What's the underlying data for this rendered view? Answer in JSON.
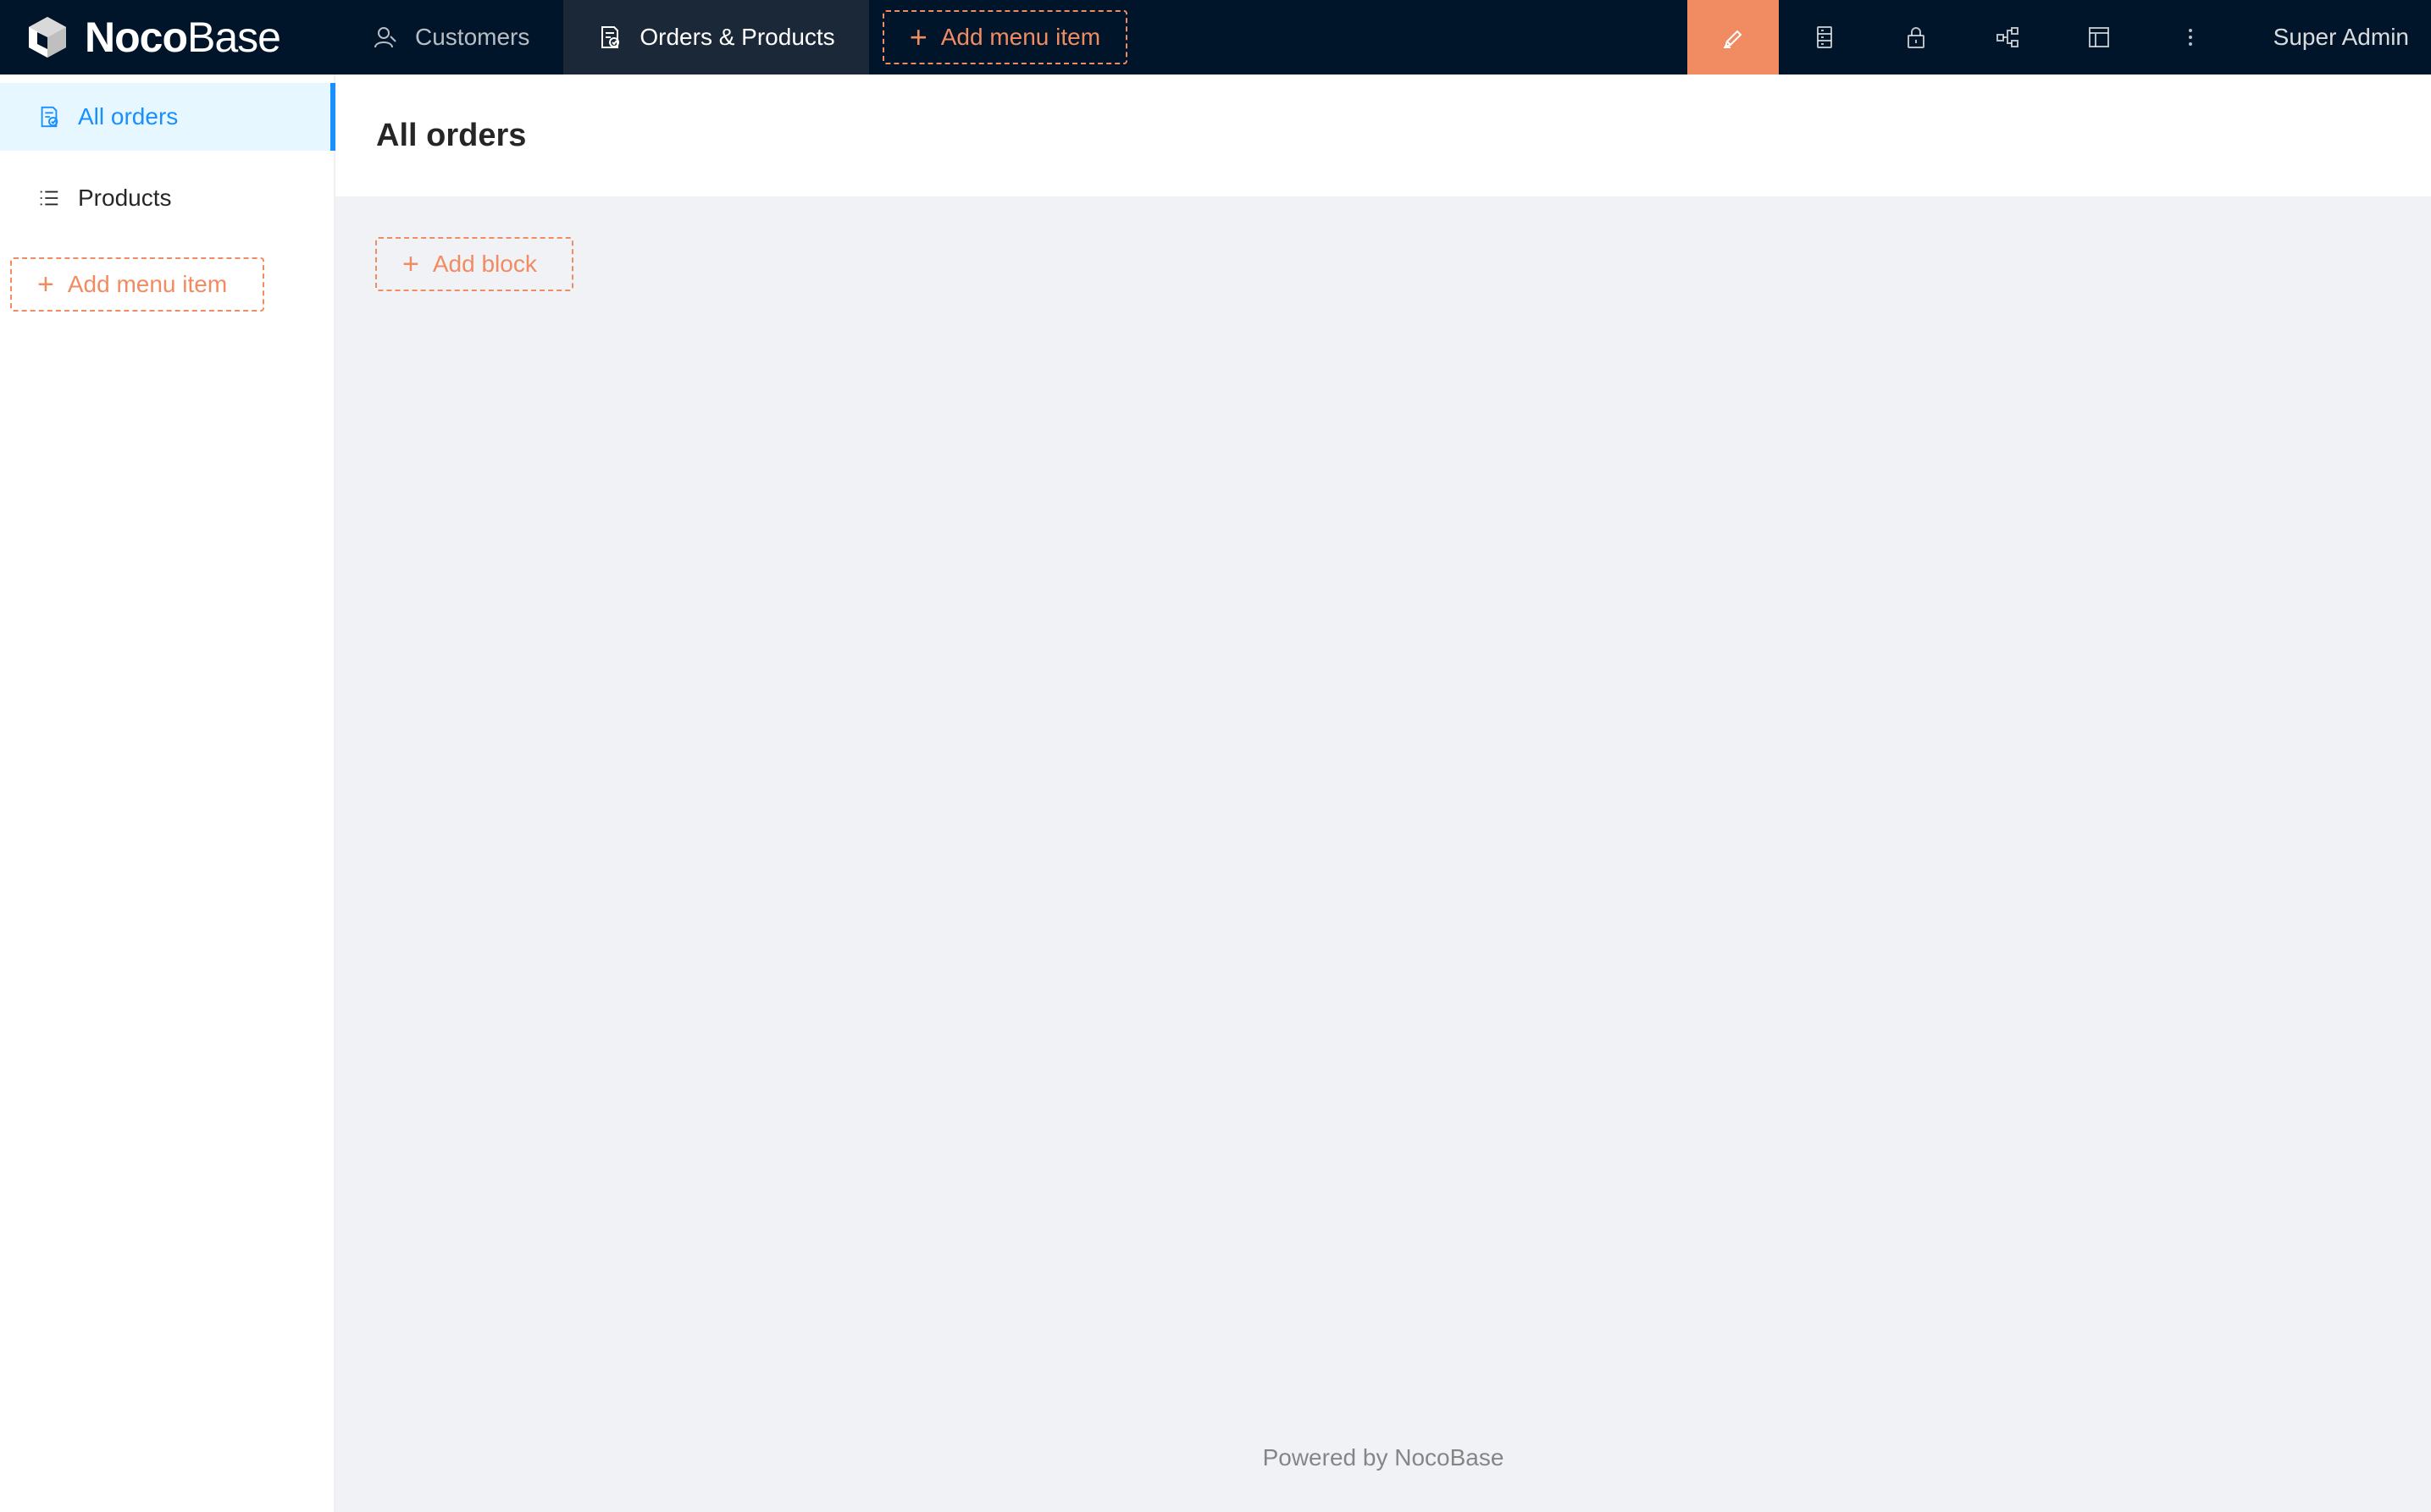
{
  "logo": {
    "part1": "Noco",
    "part2": "Base"
  },
  "topnav": {
    "items": [
      {
        "label": "Customers",
        "icon": "user-icon"
      },
      {
        "label": "Orders & Products",
        "icon": "file-check-icon"
      }
    ],
    "add_menu_item": "Add menu item"
  },
  "toolbar": {
    "icons": [
      "highlight-icon",
      "database-icon",
      "lock-icon",
      "workflow-icon",
      "layout-icon",
      "more-icon"
    ],
    "user": "Super Admin"
  },
  "sidebar": {
    "items": [
      {
        "label": "All orders",
        "icon": "file-check-icon"
      },
      {
        "label": "Products",
        "icon": "list-icon"
      }
    ],
    "add_menu_item": "Add menu item"
  },
  "page": {
    "title": "All orders",
    "add_block": "Add block"
  },
  "footer": {
    "text": "Powered by NocoBase"
  },
  "colors": {
    "header_bg": "#001529",
    "accent": "#f18b62",
    "primary": "#1890ff",
    "content_bg": "#f0f2f5"
  }
}
